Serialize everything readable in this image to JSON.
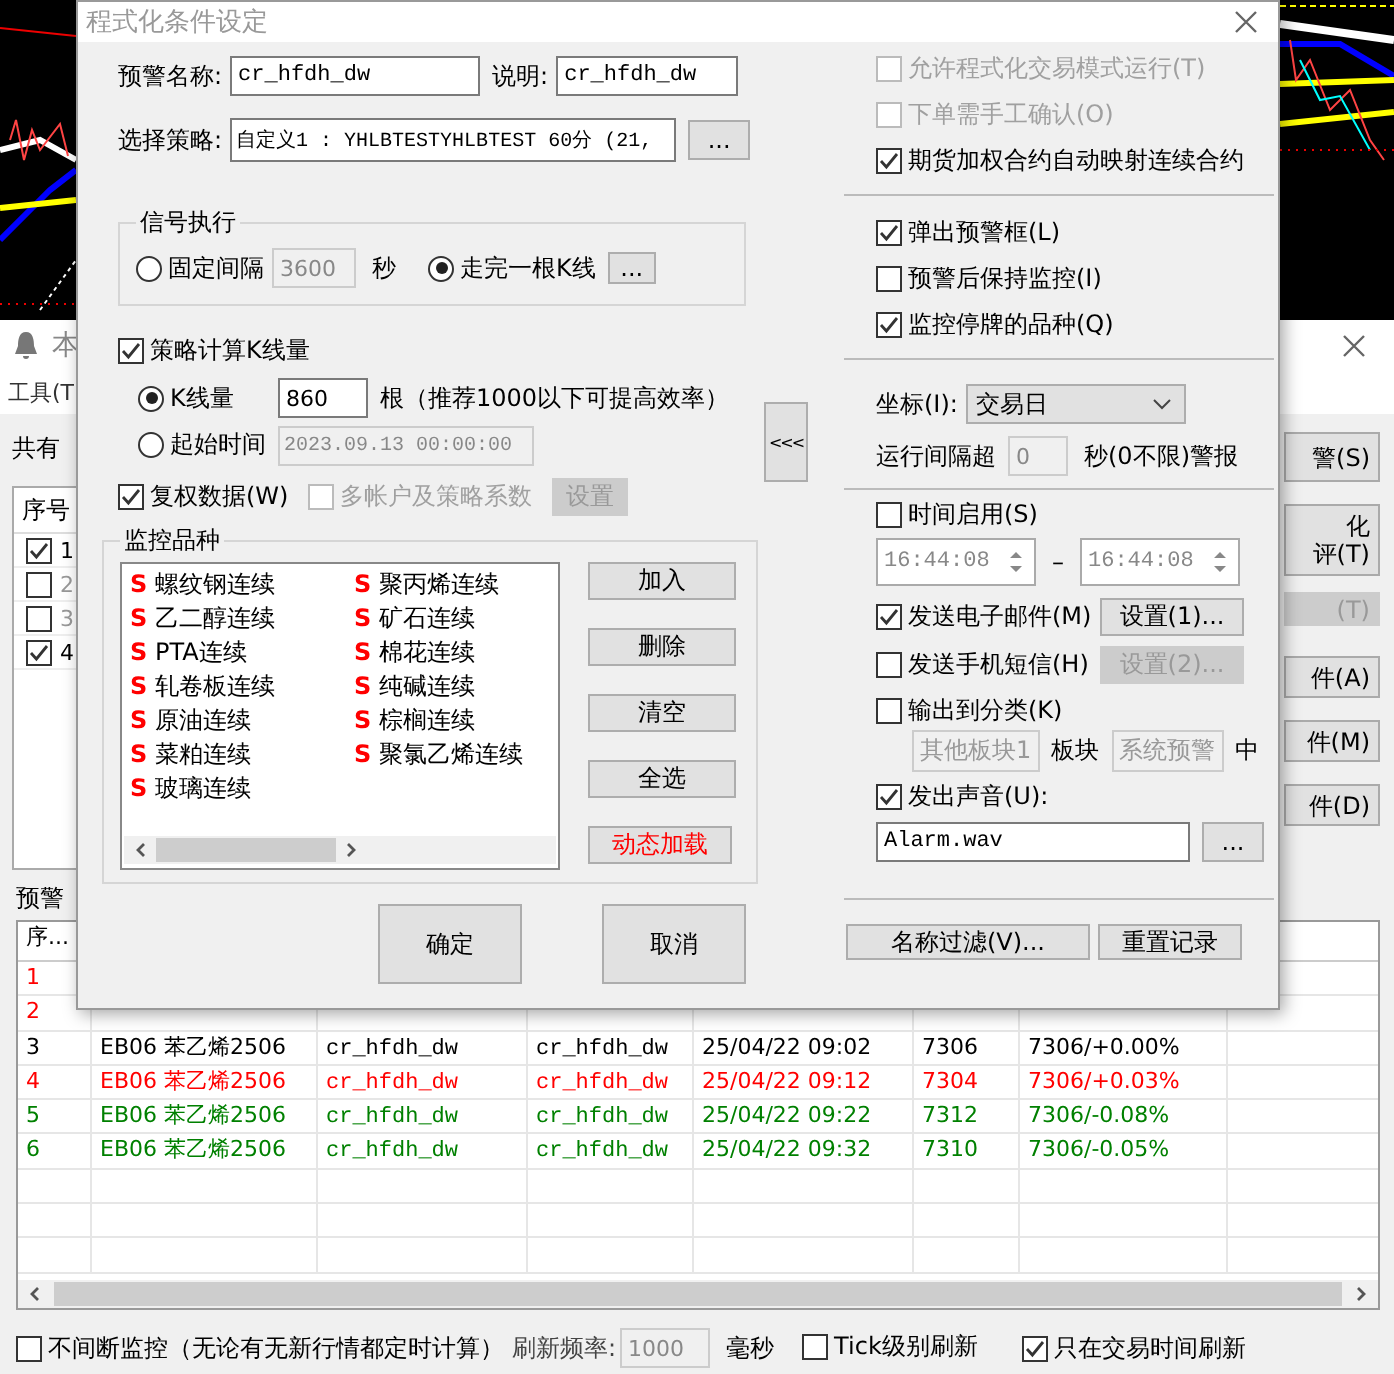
{
  "background_window": {
    "title": "本",
    "menu": [
      "工具(T"
    ],
    "shared_label": "共有",
    "left_table": {
      "header": "序号",
      "rows": [
        {
          "index": "1",
          "checked": true,
          "disabled": false
        },
        {
          "index": "2",
          "checked": false,
          "disabled": true
        },
        {
          "index": "3",
          "checked": false,
          "disabled": true
        },
        {
          "index": "4",
          "checked": true,
          "disabled": false
        }
      ]
    },
    "side_buttons": [
      {
        "lines": [
          "警(S)"
        ],
        "disabled": false
      },
      {
        "lines": [
          "化",
          "评(T)"
        ],
        "disabled": false
      },
      {
        "lines": [
          "(T)"
        ],
        "disabled": true
      },
      {
        "lines": [
          "件(A)"
        ],
        "disabled": false
      },
      {
        "lines": [
          "件(M)"
        ],
        "disabled": false
      },
      {
        "lines": [
          "件(D)"
        ],
        "disabled": false
      }
    ],
    "records_label": "预警",
    "records_table": {
      "header": "序...",
      "rows": [
        {
          "cells": [
            "1"
          ],
          "color": "#ff0000"
        },
        {
          "cells": [
            "2"
          ],
          "color": "#ff0000"
        },
        {
          "cells": [
            "3",
            "EB06 苯乙烯2506",
            "cr_hfdh_dw",
            "cr_hfdh_dw",
            "25/04/22 09:02",
            "7306",
            "7306/+0.00%"
          ],
          "color": "#000000"
        },
        {
          "cells": [
            "4",
            "EB06 苯乙烯2506",
            "cr_hfdh_dw",
            "cr_hfdh_dw",
            "25/04/22 09:12",
            "7304",
            "7306/+0.03%"
          ],
          "color": "#ff0000"
        },
        {
          "cells": [
            "5",
            "EB06 苯乙烯2506",
            "cr_hfdh_dw",
            "cr_hfdh_dw",
            "25/04/22 09:22",
            "7312",
            "7306/-0.08%"
          ],
          "color": "#008000"
        },
        {
          "cells": [
            "6",
            "EB06 苯乙烯2506",
            "cr_hfdh_dw",
            "cr_hfdh_dw",
            "25/04/22 09:32",
            "7310",
            "7306/-0.05%"
          ],
          "color": "#008000"
        }
      ]
    },
    "status_bar": {
      "continuous": {
        "label": "不间断监控（无论有无新行情都定时计算）",
        "checked": false
      },
      "refresh_label": "刷新频率:",
      "refresh_value": "1000",
      "refresh_unit": "毫秒",
      "tick_refresh": {
        "label": "Tick级别刷新",
        "checked": false
      },
      "trading_time_only": {
        "label": "只在交易时间刷新",
        "checked": true
      }
    }
  },
  "dialog": {
    "title": "程式化条件设定",
    "alert_name": {
      "label": "预警名称:",
      "value": "cr_hfdh_dw"
    },
    "description": {
      "label": "说明:",
      "value": "cr_hfdh_dw"
    },
    "strategy": {
      "label": "选择策略:",
      "value": "自定义1 : YHLBTESTYHLBTEST 60分 (21,",
      "button": "..."
    },
    "signal": {
      "title": "信号执行",
      "options": [
        {
          "label": "固定间隔",
          "selected": false
        },
        {
          "label": "走完一根K线",
          "selected": true
        }
      ],
      "interval_value": "3600",
      "interval_unit": "秒",
      "kline_button": "..."
    },
    "kline_count": {
      "label": "策略计算K线量",
      "checked": true,
      "options": [
        {
          "label": "K线量",
          "selected": true
        },
        {
          "label": "起始时间",
          "selected": false
        }
      ],
      "count_value": "860",
      "count_note": "根（推荐1000以下可提高效率）",
      "start_time": "2023.09.13 00:00:00"
    },
    "adjusted": {
      "label": "复权数据(W)",
      "checked": true
    },
    "multi_account": {
      "label": "多帐户及策略系数",
      "checked": false,
      "disabled": true
    },
    "settings_button": {
      "label": "设置",
      "disabled": true
    },
    "symbols": {
      "title": "监控品种",
      "items": [
        {
          "mark": "S",
          "name": "螺纹钢连续"
        },
        {
          "mark": "S",
          "name": "乙二醇连续"
        },
        {
          "mark": "S",
          "name": "PTA连续"
        },
        {
          "mark": "S",
          "name": "轧卷板连续"
        },
        {
          "mark": "S",
          "name": "原油连续"
        },
        {
          "mark": "S",
          "name": "菜粕连续"
        },
        {
          "mark": "S",
          "name": "玻璃连续"
        },
        {
          "mark": "S",
          "name": "聚丙烯连续"
        },
        {
          "mark": "S",
          "name": "矿石连续"
        },
        {
          "mark": "S",
          "name": "棉花连续"
        },
        {
          "mark": "S",
          "name": "纯碱连续"
        },
        {
          "mark": "S",
          "name": "棕榈连续"
        },
        {
          "mark": "S",
          "name": "聚氯乙烯连续"
        }
      ],
      "buttons": [
        {
          "label": "加入",
          "kind": "normal"
        },
        {
          "label": "删除",
          "kind": "normal"
        },
        {
          "label": "清空",
          "kind": "normal"
        },
        {
          "label": "全选",
          "kind": "normal"
        },
        {
          "label": "动态加载",
          "kind": "dynamic"
        }
      ]
    },
    "ok": "确定",
    "cancel": "取消",
    "collapse": "<<<",
    "options_top": [
      {
        "label": "允许程式化交易模式运行(T)",
        "checked": false,
        "disabled": true
      },
      {
        "label": "下单需手工确认(O)",
        "checked": false,
        "disabled": true
      },
      {
        "label": "期货加权合约自动映射连续合约",
        "checked": true,
        "disabled": false
      }
    ],
    "options_alert": [
      {
        "label": "弹出预警框(L)",
        "checked": true,
        "disabled": false
      },
      {
        "label": "预警后保持监控(I)",
        "checked": false,
        "disabled": false
      },
      {
        "label": "监控停牌的品种(Q)",
        "checked": true,
        "disabled": false
      }
    ],
    "axis": {
      "label": "坐标(I):",
      "value": "交易日"
    },
    "run_interval": {
      "label": "运行间隔超",
      "value": "0",
      "suffix": "秒(0不限)警报"
    },
    "time_enable": {
      "label": "时间启用(S)",
      "checked": false,
      "start": "16:44:08",
      "separator": "–",
      "end": "16:44:08"
    },
    "email": {
      "label": "发送电子邮件(M)",
      "checked": true,
      "button": "设置(1)...",
      "button_disabled": false
    },
    "sms": {
      "label": "发送手机短信(H)",
      "checked": false,
      "button": "设置(2)...",
      "button_disabled": true
    },
    "output": {
      "label": "输出到分类(K)",
      "checked": false,
      "block": "其他板块1",
      "block_label": "板块",
      "category": "系统预警",
      "suffix": "中"
    },
    "sound": {
      "label": "发出声音(U):",
      "checked": true,
      "file": "Alarm.wav",
      "browse": "..."
    },
    "filter_button": "名称过滤(V)...",
    "reset_button": "重置记录"
  }
}
